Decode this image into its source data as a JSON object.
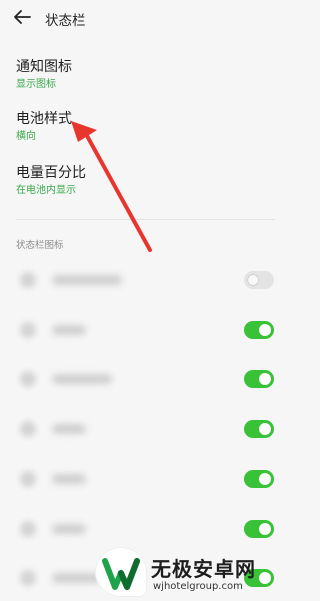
{
  "header": {
    "title": "状态栏",
    "back_icon": "arrow-left-icon"
  },
  "settings": [
    {
      "label": "通知图标",
      "value": "显示图标"
    },
    {
      "label": "电池样式",
      "value": "横向"
    },
    {
      "label": "电量百分比",
      "value": "在电池内显示"
    }
  ],
  "section": {
    "title": "状态栏图标"
  },
  "status_icons": [
    {
      "enabled": false
    },
    {
      "enabled": true
    },
    {
      "enabled": true
    },
    {
      "enabled": true
    },
    {
      "enabled": true
    },
    {
      "enabled": true
    },
    {
      "enabled": true
    }
  ],
  "colors": {
    "accent": "#39c237",
    "value_text": "#3aa84a",
    "annotation": "#e8362f"
  },
  "watermark": {
    "title": "无极安卓网",
    "url": "wjhotelgroup.com"
  }
}
